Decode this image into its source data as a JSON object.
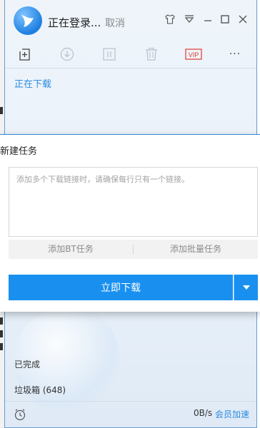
{
  "window": {
    "login_status": "正在登录...",
    "cancel_label": "取消"
  },
  "toolbar": {
    "vip_label": "VIP",
    "more_label": "···"
  },
  "sidebar": {
    "downloading_label": "正在下载",
    "completed_label": "已完成",
    "trash_label": "垃圾箱 (648)"
  },
  "footer": {
    "speed": "0B/s",
    "vip_speedup_label": "会员加速"
  },
  "dialog": {
    "title": "新建任务",
    "link_placeholder": "添加多个下载链接时，请确保每行只有一个链接。",
    "add_bt_label": "添加BT任务",
    "add_batch_label": "添加批量任务",
    "download_now_label": "立即下载"
  },
  "colors": {
    "accent": "#1990f0",
    "link": "#2b8be0",
    "vip": "#e33b2e"
  },
  "icons": [
    "app-logo",
    "tshirt-icon",
    "dropdown-menu-icon",
    "minimize-icon",
    "maximize-icon",
    "close-icon",
    "new-task-icon",
    "download-icon",
    "pause-icon",
    "delete-icon",
    "vip-icon",
    "more-icon",
    "clock-icon",
    "chevron-down-icon"
  ]
}
